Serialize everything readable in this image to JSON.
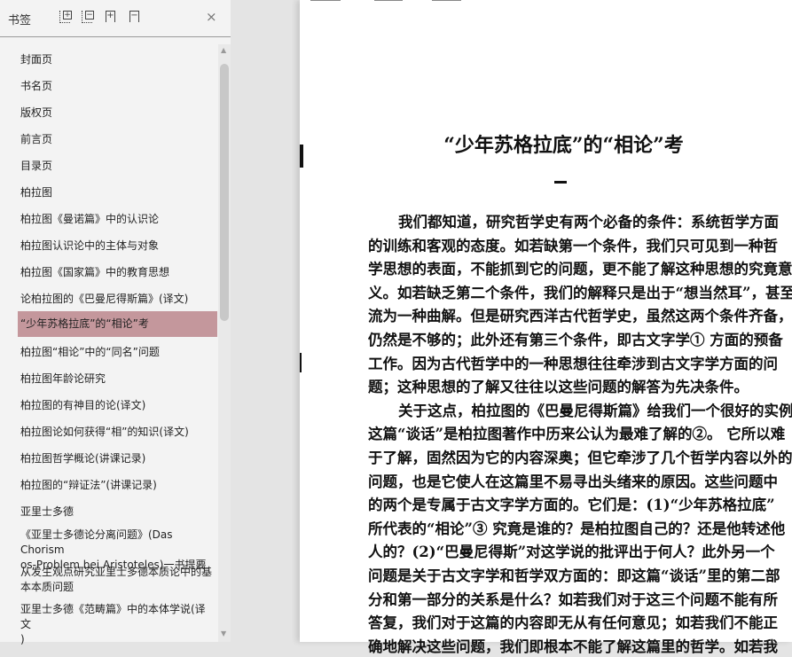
{
  "sidebar": {
    "title": "书签",
    "icons": [
      "expand-all-icon",
      "collapse-all-icon",
      "add-bookmark-icon",
      "remove-bookmark-icon",
      "close-icon"
    ],
    "close": "×",
    "selected_index": 10,
    "items": [
      {
        "label": "封面页"
      },
      {
        "label": "书名页"
      },
      {
        "label": "版权页"
      },
      {
        "label": "前言页"
      },
      {
        "label": "目录页"
      },
      {
        "label": "柏拉图"
      },
      {
        "label": "柏拉图《曼诺篇》中的认识论"
      },
      {
        "label": "柏拉图认识论中的主体与对象"
      },
      {
        "label": "柏拉图《国家篇》中的教育思想"
      },
      {
        "label": "论柏拉图的《巴曼尼得斯篇》(译文)"
      },
      {
        "label": "“少年苏格拉底”的“相论”考"
      },
      {
        "label": "柏拉图“相论”中的“同名”问题"
      },
      {
        "label": "柏拉图年龄论研究"
      },
      {
        "label": "柏拉图的有神目的论(译文)"
      },
      {
        "label": "柏拉图论如何获得“相”的知识(译文)"
      },
      {
        "label": "柏拉图哲学概论(讲课记录)"
      },
      {
        "label": "柏拉图的“辩证法”(讲课记录)"
      },
      {
        "label": "亚里士多德"
      },
      {
        "label": "《亚里士多德论分离问题》(Das Chorismos-Problem bei Aristoteles)一书提要",
        "l1": "《亚里士多德论分离问题》(Das Chorism",
        "l2": "os-Problem bei Aristoteles)一书提要"
      },
      {
        "label": "从发生观点研究亚里士多德本质论中的基本本质问题",
        "l1": "从发生观点研究亚里士多德本质论中的基",
        "l2": "本本质问题"
      },
      {
        "label": "亚里士多德《范畴篇》中的本体学说(译文)",
        "l1": "亚里士多德《范畴篇》中的本体学说(译文",
        "l2": ")"
      }
    ]
  },
  "document": {
    "title": "“少年苏格拉底”的“相论”考",
    "section": "一",
    "lines": [
      "我们都知道，研究哲学史有两个必备的条件：系统哲学方面",
      "的训练和客观的态度。如若缺第一个条件，我们只可见到一种哲",
      "学思想的表面，不能抓到它的问题，更不能了解这种思想的究竟意",
      "义。如若缺乏第二个条件，我们的解释只是出于“想当然耳”，甚至",
      "流为一种曲解。但是研究西洋古代哲学史，虽然这两个条件齐备，",
      "仍然是不够的；此外还有第三个条件，即古文字学① 方面的预备",
      "工作。因为古代哲学中的一种思想往往牵涉到古文字学方面的问",
      "题；这种思想的了解又往往以这些问题的解答为先决条件。",
      "关于这点，柏拉图的《巴曼尼得斯篇》给我们一个很好的实例。",
      "这篇“谈话”是柏拉图著作中历来公认为最难了解的②。 它所以难",
      "于了解，固然因为它的内容深奥；但它牵涉了几个哲学内容以外的",
      "问题，也是它使人在这篇里不易寻出头绪来的原因。这些问题中",
      "的两个是专属于古文字学方面的。它们是：(1)“少年苏格拉底”",
      "所代表的“相论”③ 究竟是谁的？是柏拉图自己的？还是他转述他",
      "人的？(2)“巴曼尼得斯”对这学说的批评出于何人？此外另一个",
      "问题是关于古文字学和哲学双方面的：即这篇“谈话”里的第二部",
      "分和第一部分的关系是什么？如若我们对于这三个问题不能有所",
      "答复，我们对于这篇的内容即无从有任何意见；如若我们不能正",
      "确地解决这些问题，我们即根本不能了解这篇里的哲学。如若我"
    ]
  },
  "colors": {
    "selected": "#c4979c",
    "sidebar_bg": "#f3f3f3"
  }
}
